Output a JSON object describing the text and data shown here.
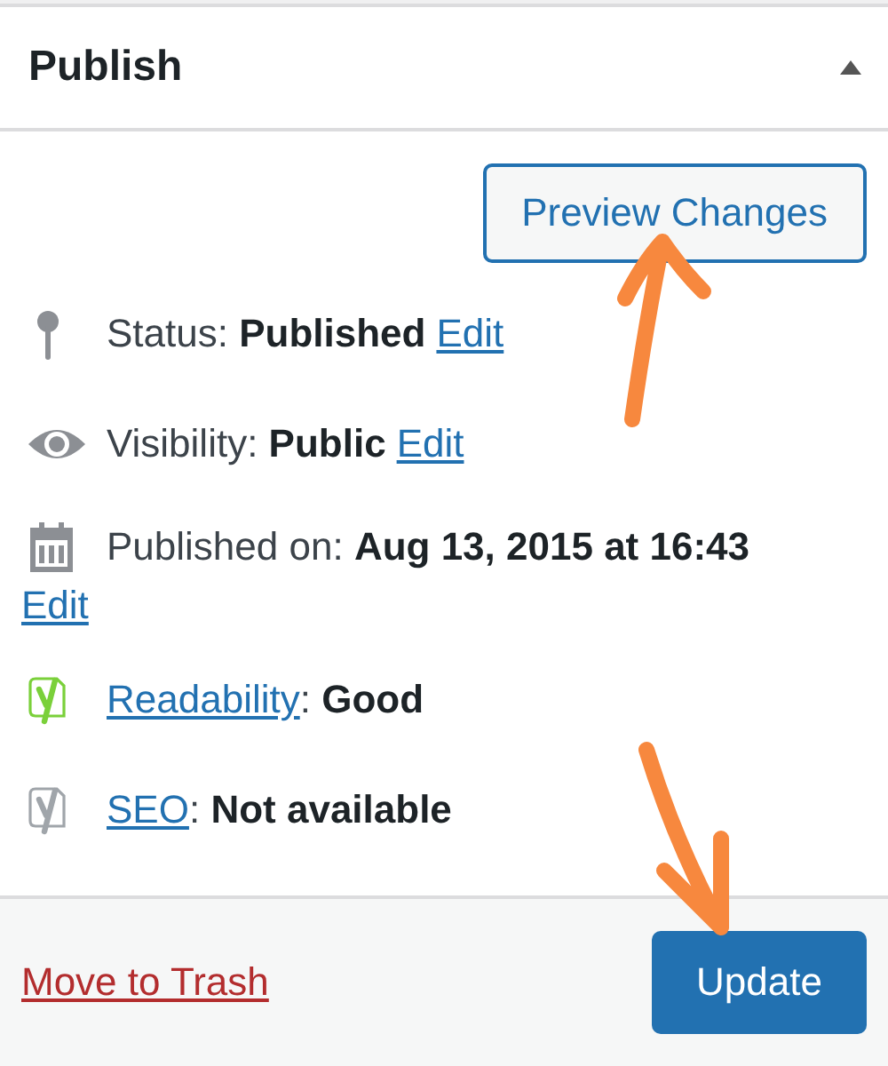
{
  "panel": {
    "title": "Publish",
    "expanded": true
  },
  "preview_button": {
    "label": "Preview Changes"
  },
  "items": [
    {
      "kind": "status",
      "text": "Status: **Published**",
      "link": "Edit"
    },
    {
      "kind": "visibility",
      "text": "Visibility: **Public**",
      "link": "Edit"
    },
    {
      "kind": "date",
      "text": "Published on: **Aug 13, 2015 at 16:43**",
      "link": "Edit"
    },
    {
      "kind": "readability",
      "link": "Readability",
      "text": ": **Good**",
      "color": "#7ad03a"
    },
    {
      "kind": "seo",
      "link": "SEO",
      "text": ": **Not available**",
      "color": "#a0a5aa"
    }
  ],
  "footer": {
    "trash_link": "Move to Trash",
    "update_button": "Update"
  },
  "annotations": [
    {
      "kind": "arrow"
    },
    {
      "kind": "arrow"
    }
  ]
}
